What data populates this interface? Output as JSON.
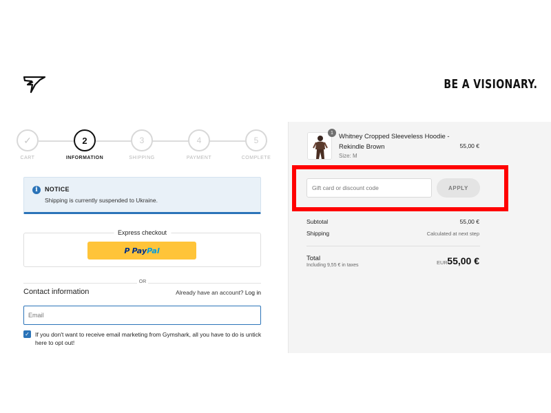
{
  "header": {
    "logo_icon": "gymshark-logo",
    "slogan": "BE A VISIONARY."
  },
  "stepper": {
    "steps": [
      {
        "number": "",
        "label": "CART",
        "state": "done"
      },
      {
        "number": "2",
        "label": "INFORMATION",
        "state": "active"
      },
      {
        "number": "3",
        "label": "SHIPPING",
        "state": "upcoming"
      },
      {
        "number": "4",
        "label": "PAYMENT",
        "state": "upcoming"
      },
      {
        "number": "5",
        "label": "COMPLETE",
        "state": "upcoming"
      }
    ],
    "check_icon": "✓"
  },
  "notice": {
    "icon": "i",
    "title": "NOTICE",
    "message": "Shipping is currently suspended to Ukraine.",
    "accent_color": "#2a73b8"
  },
  "express_checkout": {
    "title": "Express checkout",
    "paypal_mark": "P",
    "paypal_pay": "Pay",
    "paypal_pal": "Pal",
    "button_color": "#ffc439"
  },
  "divider": {
    "or_label": "OR"
  },
  "contact": {
    "title": "Contact information",
    "account_prompt": "Already have an account?",
    "login_label": "Log in",
    "email_value": "",
    "email_placeholder": "Email",
    "marketing_checked": true,
    "marketing_text": "If you don't want to receive email marketing from Gymshark, all you have to do is untick here to opt out!"
  },
  "order_summary": {
    "item": {
      "quantity": "1",
      "name": "Whitney Cropped Sleeveless Hoodie - Rekindle Brown",
      "size": "Size: M",
      "price": "55,00 €"
    },
    "discount": {
      "placeholder": "Gift card or discount code",
      "value": "",
      "apply_label": "APPLY",
      "highlight_color": "#ff0000"
    },
    "subtotal_label": "Subtotal",
    "subtotal_value": "55,00 €",
    "shipping_label": "Shipping",
    "shipping_value": "Calculated at next step",
    "total_label": "Total",
    "tax_note": "Including 9,55 € in taxes",
    "currency": "EUR",
    "total_value": "55,00 €"
  }
}
